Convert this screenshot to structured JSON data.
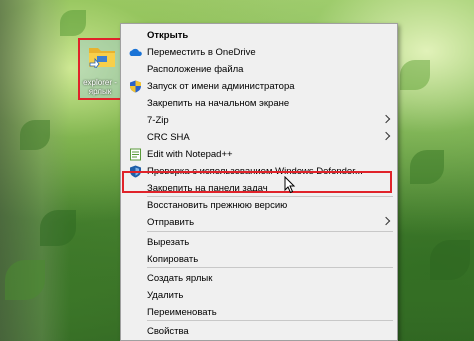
{
  "desktop": {
    "icon_label": "explorer - ярлык"
  },
  "menu": {
    "items": [
      {
        "label": "Открыть",
        "icon": "none",
        "bold": true
      },
      {
        "label": "Переместить в OneDrive",
        "icon": "onedrive-icon"
      },
      {
        "label": "Расположение файла",
        "icon": "none"
      },
      {
        "label": "Запуск от имени администратора",
        "icon": "uac-shield-icon"
      },
      {
        "label": "Закрепить на начальном экране",
        "icon": "none"
      },
      {
        "label": "7-Zip",
        "icon": "none",
        "submenu": true
      },
      {
        "label": "CRC SHA",
        "icon": "none",
        "submenu": true
      },
      {
        "label": "Edit with Notepad++",
        "icon": "notepadpp-icon"
      },
      {
        "label": "Проверка с использованием Windows Defender...",
        "icon": "defender-icon"
      },
      {
        "label": "Закрепить на панели задач",
        "icon": "none"
      },
      {
        "label": "Восстановить прежнюю версию",
        "icon": "none"
      },
      {
        "label": "Отправить",
        "icon": "none",
        "submenu": true
      },
      {
        "label": "Вырезать",
        "icon": "none"
      },
      {
        "label": "Копировать",
        "icon": "none"
      },
      {
        "label": "Создать ярлык",
        "icon": "none"
      },
      {
        "label": "Удалить",
        "icon": "none"
      },
      {
        "label": "Переименовать",
        "icon": "none"
      },
      {
        "label": "Свойства",
        "icon": "none"
      }
    ]
  },
  "colors": {
    "highlight_border": "#e0232a",
    "menu_bg": "#f0f0f0"
  }
}
